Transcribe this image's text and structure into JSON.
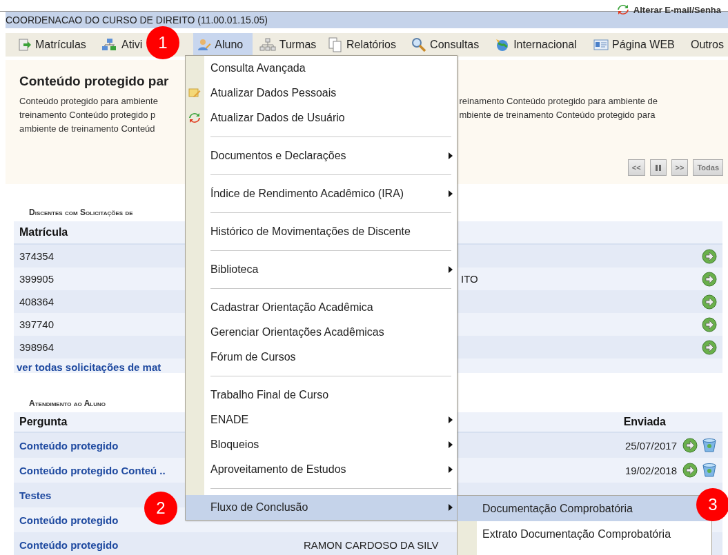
{
  "header": {
    "title": "COORDENACAO DO CURSO DE DIREITO (11.00.01.15.05)",
    "account_link": "Alterar E-mail/Senha"
  },
  "menubar": [
    {
      "label": "Matrículas",
      "selected": false
    },
    {
      "label": "Ativi",
      "selected": false
    },
    {
      "label": "Aluno",
      "selected": true
    },
    {
      "label": "Turmas",
      "selected": false
    },
    {
      "label": "Relatórios",
      "selected": false
    },
    {
      "label": "Consultas",
      "selected": false
    },
    {
      "label": "Internacional",
      "selected": false
    },
    {
      "label": "Página WEB",
      "selected": false
    },
    {
      "label": "Outros",
      "selected": false
    }
  ],
  "banner": {
    "title": "Conteúdo protegido par",
    "text_left": [
      "Conteúdo protegido para ambiente",
      "treinamento Conteúdo protegido p",
      "ambiente de treinamento Conteúd"
    ],
    "text_right": [
      "reinamento Conteúdo protegido para ambiente de",
      "mbiente de treinamento Conteúdo protegido para"
    ],
    "controls": [
      {
        "kind": "text",
        "label": "<<"
      },
      {
        "kind": "pause"
      },
      {
        "kind": "text",
        "label": ">>"
      },
      {
        "kind": "text",
        "label": "Todas"
      }
    ]
  },
  "discentes": {
    "title": "Discentes com Solicitações de",
    "columns": [
      "Matrícula"
    ],
    "rows": [
      {
        "matricula": "374354"
      },
      {
        "matricula": "399905",
        "column_2": "ITO"
      },
      {
        "matricula": "408364"
      },
      {
        "matricula": "397740"
      },
      {
        "matricula": "398964"
      }
    ],
    "link": "ver todas solicitações de mat"
  },
  "atendimento": {
    "title": "Atendimento ao Aluno",
    "columns": [
      "Pergunta",
      "Enviada"
    ],
    "rows": [
      {
        "pergunta": "Conteúdo protegido",
        "enviada": "25/07/2017",
        "actions": true
      },
      {
        "pergunta": "Conteúdo protegido Conteú ..",
        "enviada": "19/02/2018",
        "actions": true
      },
      {
        "pergunta": "Testes",
        "actions": false
      },
      {
        "pergunta": "Conteúdo protegido",
        "actions": false
      },
      {
        "pergunta": "Conteúdo protegido",
        "column_2": "RAMON CARDOSO DA SILV",
        "actions": false
      }
    ]
  },
  "dropdown": [
    {
      "kind": "item",
      "label": "Consulta Avançada",
      "submenu": false,
      "selected": false
    },
    {
      "kind": "item",
      "label": "Atualizar Dados Pessoais",
      "submenu": false,
      "selected": false
    },
    {
      "kind": "item",
      "label": "Atualizar Dados de Usuário",
      "submenu": false,
      "selected": false
    },
    {
      "kind": "separator"
    },
    {
      "kind": "item",
      "label": "Documentos e Declarações",
      "submenu": true,
      "selected": false
    },
    {
      "kind": "separator"
    },
    {
      "kind": "item",
      "label": "Índice de Rendimento Acadêmico (IRA)",
      "submenu": true,
      "selected": false
    },
    {
      "kind": "separator"
    },
    {
      "kind": "item",
      "label": "Histórico de Movimentações de Discente",
      "submenu": false,
      "selected": false
    },
    {
      "kind": "separator"
    },
    {
      "kind": "item",
      "label": "Biblioteca",
      "submenu": true,
      "selected": false
    },
    {
      "kind": "separator"
    },
    {
      "kind": "item",
      "label": "Cadastrar Orientação Acadêmica",
      "submenu": false,
      "selected": false
    },
    {
      "kind": "item",
      "label": "Gerenciar Orientações Acadêmicas",
      "submenu": false,
      "selected": false
    },
    {
      "kind": "item",
      "label": "Fórum de Cursos",
      "submenu": false,
      "selected": false
    },
    {
      "kind": "separator"
    },
    {
      "kind": "item",
      "label": "Trabalho Final de Curso",
      "submenu": false,
      "selected": false
    },
    {
      "kind": "item",
      "label": "ENADE",
      "submenu": true,
      "selected": false
    },
    {
      "kind": "item",
      "label": "Bloqueios",
      "submenu": true,
      "selected": false
    },
    {
      "kind": "item",
      "label": "Aproveitamento de Estudos",
      "submenu": true,
      "selected": false
    },
    {
      "kind": "separator"
    },
    {
      "kind": "item",
      "label": "Fluxo de Conclusão",
      "submenu": true,
      "selected": true
    }
  ],
  "submenu": [
    {
      "label": "Documentação Comprobatória",
      "selected": true
    },
    {
      "label": "Extrato Documentação Comprobatória",
      "selected": false
    }
  ],
  "callouts": [
    "1",
    "2",
    "3"
  ]
}
